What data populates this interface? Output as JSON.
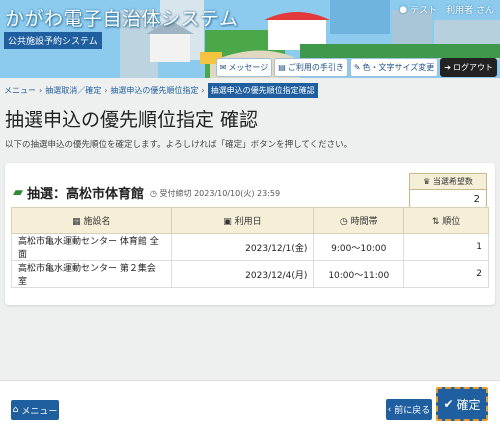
{
  "header": {
    "title": "かがわ電子自治体システム",
    "subtitle": "公共施設予約システム",
    "user_label": "テスト　利用者 さん",
    "buttons": [
      {
        "label": "メッセージ",
        "icon": "chat-icon"
      },
      {
        "label": "ご利用の手引き",
        "icon": "book-icon"
      },
      {
        "label": "色・文字サイズ変更",
        "icon": "brush-icon"
      },
      {
        "label": "ログアウト",
        "icon": "logout-icon"
      }
    ]
  },
  "breadcrumb": {
    "items": [
      "メニュー",
      "抽選取消／確定",
      "抽選申込の優先順位指定"
    ],
    "current": "抽選申込の優先順位指定確認"
  },
  "page": {
    "title": "抽選申込の優先順位指定 確認",
    "description": "以下の抽選申込の優先順位を確定します。よろしければ「確定」ボタンを押してください。"
  },
  "card": {
    "title": "抽選：高松市体育館",
    "deadline_label": "受付締切",
    "deadline": "2023/10/10(火) 23:59",
    "hope_label": "当選希望数",
    "hope_value": "2",
    "columns": [
      "施設名",
      "利用日",
      "時間帯",
      "順位"
    ],
    "rows": [
      {
        "facility": "高松市亀水運動センター 体育館 全面",
        "date": "2023/12/1(金)",
        "time": "9:00～10:00",
        "rank": "1"
      },
      {
        "facility": "高松市亀水運動センター 第２集会室",
        "date": "2023/12/4(月)",
        "time": "10:00～11:00",
        "rank": "2"
      }
    ]
  },
  "footer": {
    "menu_label": "メニュー",
    "back_label": "前に戻る",
    "confirm_label": "確定"
  },
  "colors": {
    "accent": "#1f5fa0",
    "table_header": "#f6efd8",
    "confirm_focus": "#e39a30"
  }
}
